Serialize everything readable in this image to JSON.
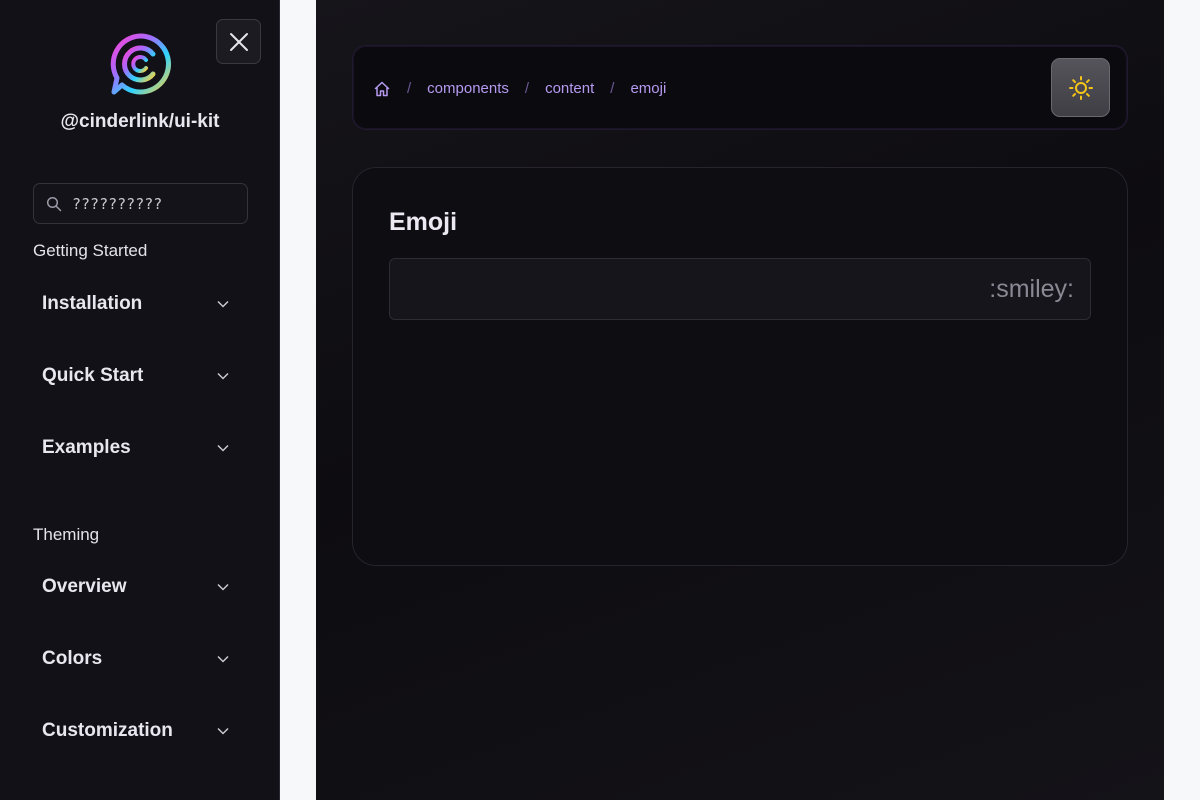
{
  "sidebar": {
    "package_name": "@cinderlink/ui-kit",
    "search_placeholder": "??????????",
    "sections": [
      {
        "label": "Getting Started",
        "items": [
          {
            "label": "Installation"
          },
          {
            "label": "Quick Start"
          },
          {
            "label": "Examples"
          }
        ]
      },
      {
        "label": "Theming",
        "items": [
          {
            "label": "Overview"
          },
          {
            "label": "Colors"
          },
          {
            "label": "Customization"
          }
        ]
      }
    ],
    "close_icon": "close-icon",
    "item_icon": "chevron-down-icon"
  },
  "breadcrumb": {
    "home_icon": "home-icon",
    "separator": "/",
    "items": [
      "components",
      "content",
      "emoji"
    ]
  },
  "theme_toggle": {
    "icon": "sun-icon",
    "color": "#f5c518"
  },
  "card": {
    "title": "Emoji",
    "field_value": ":smiley:"
  },
  "colors": {
    "accent": "#b59af0",
    "sidebar_bg": "#121117",
    "main_bg": "#0e0d12"
  }
}
